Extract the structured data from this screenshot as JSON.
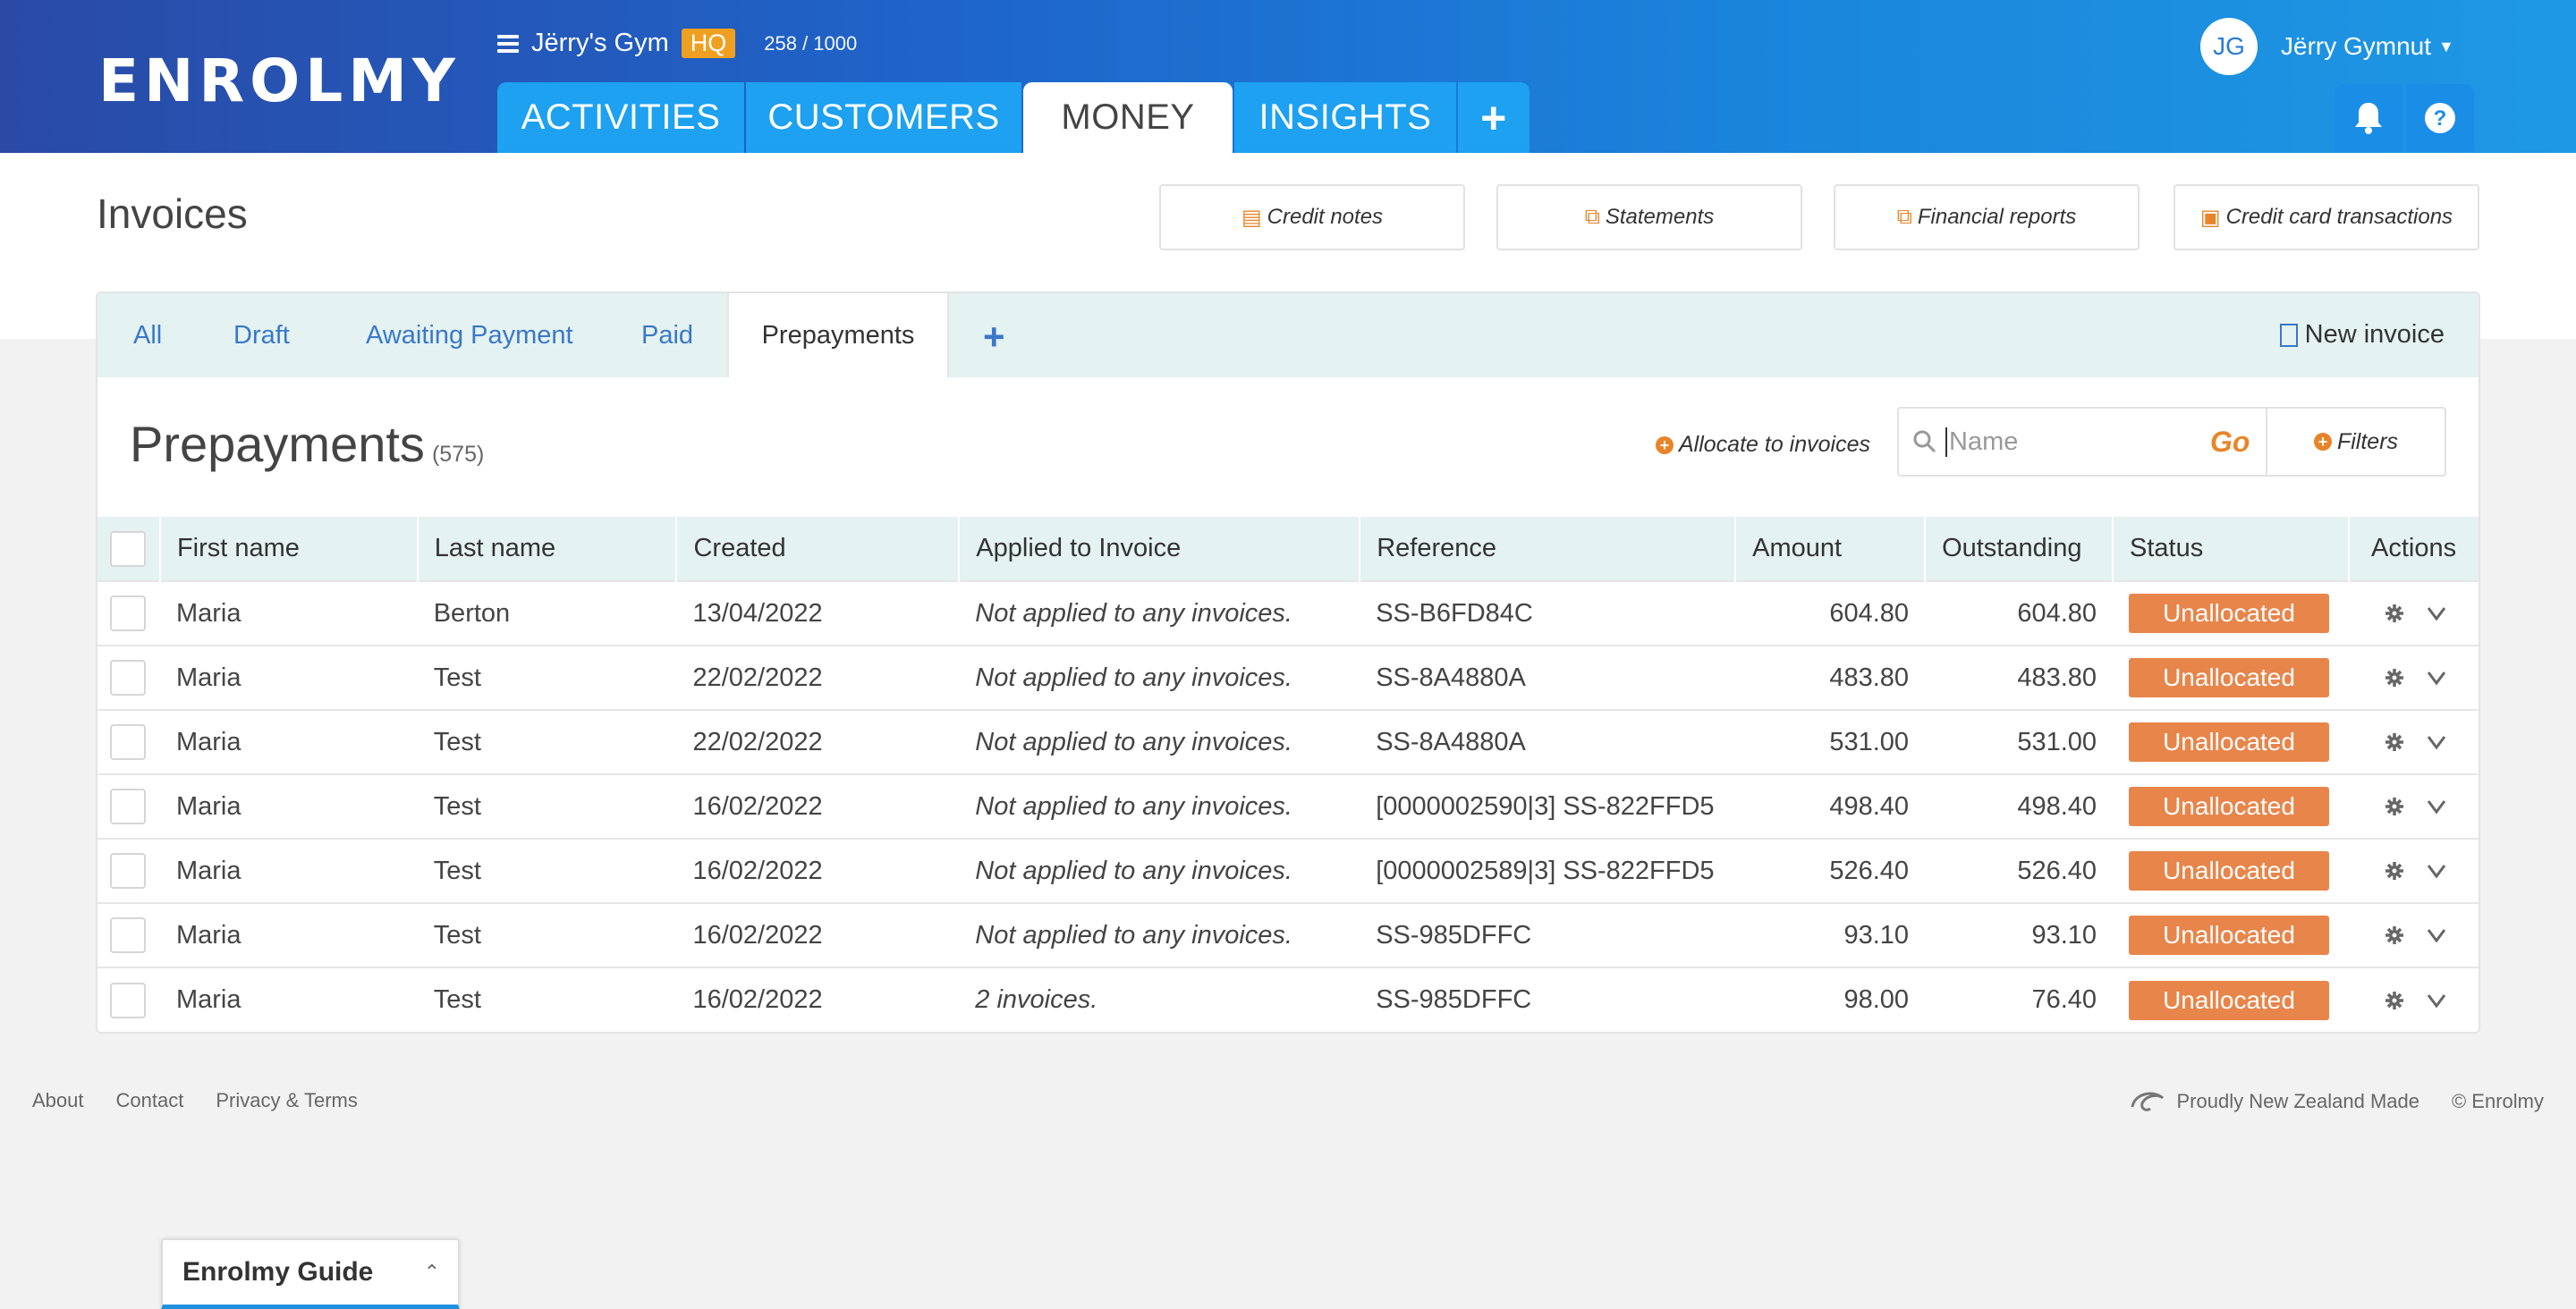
{
  "app": {
    "logo": "ENROLMY",
    "gym_name": "Jërry's Gym",
    "hq_badge": "HQ",
    "member_count": "258 / 1000",
    "user_initials": "JG",
    "user_name": "Jërry Gymnut"
  },
  "main_tabs": [
    {
      "label": "ACTIVITIES",
      "active": false
    },
    {
      "label": "CUSTOMERS",
      "active": false
    },
    {
      "label": "MONEY",
      "active": true
    },
    {
      "label": "INSIGHTS",
      "active": false
    },
    {
      "label": "+",
      "active": false
    }
  ],
  "page": {
    "title": "Invoices",
    "top_buttons": [
      {
        "label": "Credit notes",
        "icon": "banknote-icon"
      },
      {
        "label": "Statements",
        "icon": "copy-icon"
      },
      {
        "label": "Financial reports",
        "icon": "copy-icon"
      },
      {
        "label": "Credit card transactions",
        "icon": "credit-card-icon"
      }
    ]
  },
  "sub_tabs": [
    {
      "label": "All",
      "active": false
    },
    {
      "label": "Draft",
      "active": false
    },
    {
      "label": "Awaiting Payment",
      "active": false
    },
    {
      "label": "Paid",
      "active": false
    },
    {
      "label": "Prepayments",
      "active": true
    }
  ],
  "sub_tab_add": "+",
  "new_invoice_label": "New invoice",
  "section": {
    "title": "Prepayments",
    "count": "(575)",
    "allocate_label": "Allocate to invoices",
    "search_placeholder": "Name",
    "search_go": "Go",
    "filters_label": "Filters"
  },
  "table": {
    "headers": [
      "First name",
      "Last name",
      "Created",
      "Applied to Invoice",
      "Reference",
      "Amount",
      "Outstanding",
      "Status",
      "Actions"
    ],
    "rows": [
      {
        "first": "Maria",
        "last": "Berton",
        "created": "13/04/2022",
        "applied": "Not applied to any invoices.",
        "reference": "SS-B6FD84C",
        "amount": "604.80",
        "outstanding": "604.80",
        "status": "Unallocated"
      },
      {
        "first": "Maria",
        "last": "Test",
        "created": "22/02/2022",
        "applied": "Not applied to any invoices.",
        "reference": "SS-8A4880A",
        "amount": "483.80",
        "outstanding": "483.80",
        "status": "Unallocated"
      },
      {
        "first": "Maria",
        "last": "Test",
        "created": "22/02/2022",
        "applied": "Not applied to any invoices.",
        "reference": "SS-8A4880A",
        "amount": "531.00",
        "outstanding": "531.00",
        "status": "Unallocated"
      },
      {
        "first": "Maria",
        "last": "Test",
        "created": "16/02/2022",
        "applied": "Not applied to any invoices.",
        "reference": "[0000002590|3] SS-822FFD5",
        "amount": "498.40",
        "outstanding": "498.40",
        "status": "Unallocated"
      },
      {
        "first": "Maria",
        "last": "Test",
        "created": "16/02/2022",
        "applied": "Not applied to any invoices.",
        "reference": "[0000002589|3] SS-822FFD5",
        "amount": "526.40",
        "outstanding": "526.40",
        "status": "Unallocated"
      },
      {
        "first": "Maria",
        "last": "Test",
        "created": "16/02/2022",
        "applied": "Not applied to any invoices.",
        "reference": "SS-985DFFC",
        "amount": "93.10",
        "outstanding": "93.10",
        "status": "Unallocated"
      },
      {
        "first": "Maria",
        "last": "Test",
        "created": "16/02/2022",
        "applied": "2 invoices.",
        "reference": "SS-985DFFC",
        "amount": "98.00",
        "outstanding": "76.40",
        "status": "Unallocated"
      }
    ]
  },
  "footer": {
    "links": [
      "About",
      "Contact",
      "Privacy & Terms"
    ],
    "nz_made": "Proudly New Zealand Made",
    "copyright": "© Enrolmy"
  },
  "guide": {
    "label": "Enrolmy Guide"
  },
  "colors": {
    "accent_orange": "#e8852a",
    "status_unallocated": "#e8854a",
    "tab_blue": "#1da1f0",
    "link_blue": "#3a78c9"
  }
}
